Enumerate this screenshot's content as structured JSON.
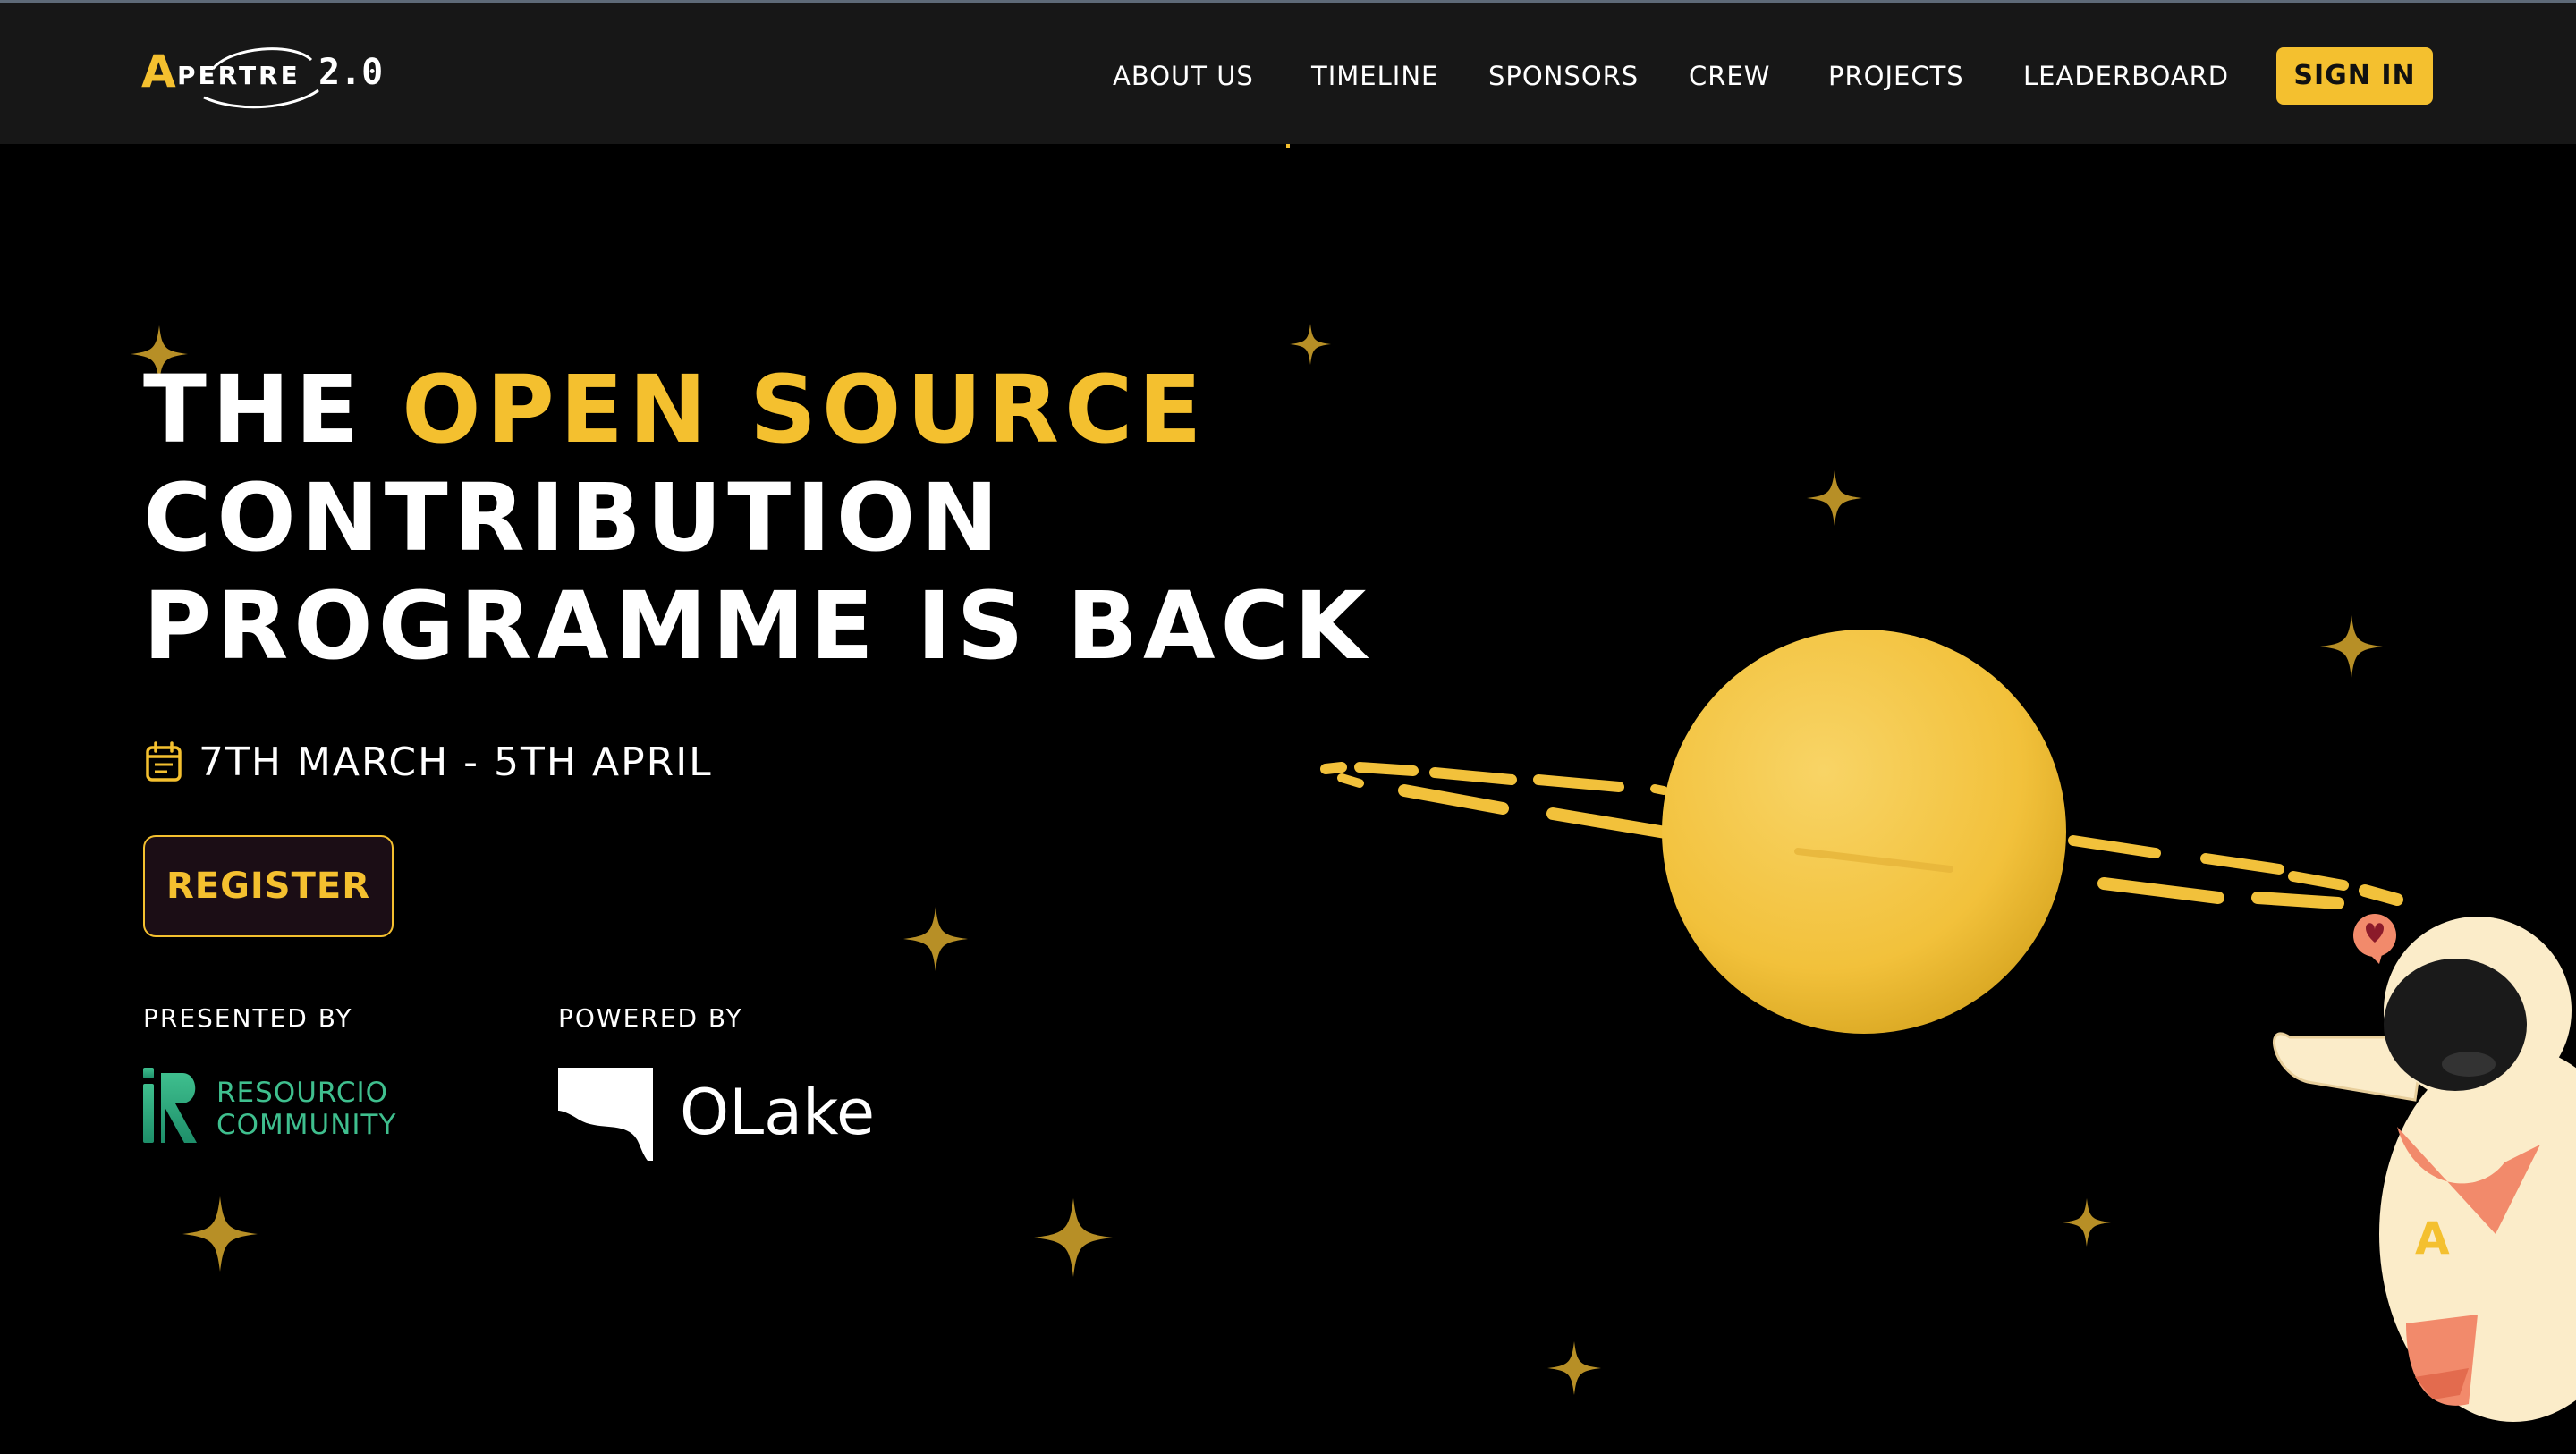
{
  "header": {
    "logo_text": "PERTRE",
    "logo_letter": "A",
    "logo_version": "2.0",
    "nav": [
      {
        "label": "ABOUT US"
      },
      {
        "label": "TIMELINE"
      },
      {
        "label": "SPONSORS"
      },
      {
        "label": "CREW"
      },
      {
        "label": "PROJECTS"
      },
      {
        "label": "LEADERBOARD"
      }
    ],
    "signin_label": "SIGN IN"
  },
  "hero": {
    "title_line1_plain": "THE ",
    "title_line1_accent": "OPEN SOURCE",
    "title_line2": "CONTRIBUTION",
    "title_line3": "PROGRAMME IS BACK",
    "dates": "7TH MARCH - 5TH APRIL",
    "register_label": "REGISTER"
  },
  "sponsors": {
    "presented_by_label": "PRESENTED BY",
    "resourcio_line1": "RESOURCIO",
    "resourcio_line2": "COMMUNITY",
    "powered_by_label": "POWERED BY",
    "olake_name": "OLake"
  },
  "icons": {
    "calendar": "calendar-icon",
    "stars": "star-icon",
    "planet": "planet-illustration",
    "astronaut": "astronaut-illustration"
  },
  "colors": {
    "accent": "#f4c02f",
    "header_bg": "#171717",
    "page_bg": "#000000",
    "register_bg": "#1b0d15",
    "resourcio_green": "#3fbf8e",
    "astronaut_suit": "#fbecc9",
    "astronaut_orange": "#f28a6b"
  }
}
